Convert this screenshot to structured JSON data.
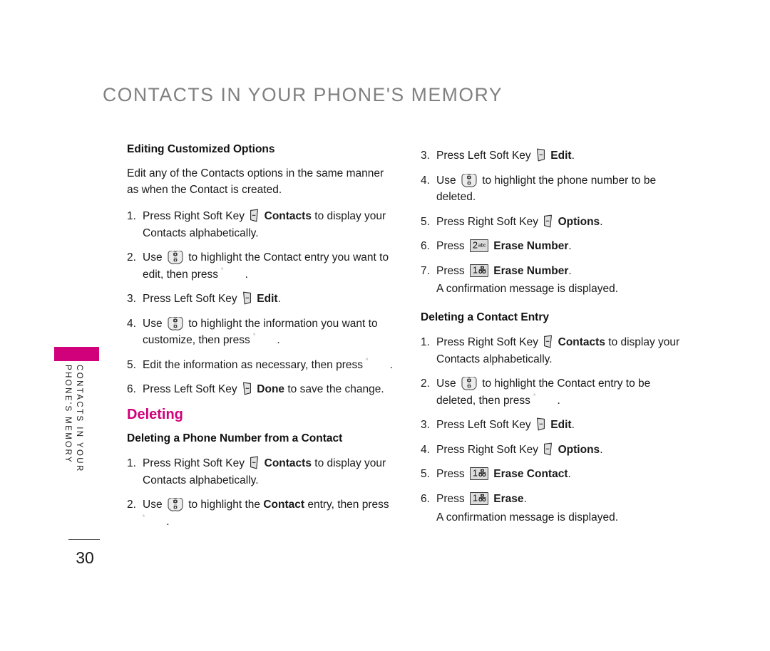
{
  "page": {
    "title": "CONTACTS IN YOUR PHONE'S MEMORY",
    "number": "30",
    "tab_color": "#d1007b",
    "heading_color": "#808080"
  },
  "side_tab": {
    "line1": "CONTACTS IN YOUR",
    "line2": "PHONE'S MEMORY"
  },
  "icons": {
    "left_soft_key": "left-soft-key-icon",
    "right_soft_key": "right-soft-key-icon",
    "nav_key": "navigation-key-icon",
    "ok_key": "ok-key-icon",
    "ok_label": "OK",
    "key_1": "number-key-1-icon",
    "key_1_digit": "1",
    "key_2": "number-key-2-icon",
    "key_2_digit": "2",
    "key_2_sub": "abc"
  },
  "left_column": {
    "editing_heading": "Editing Customized Options",
    "editing_intro": "Edit any of the Contacts options in the same manner as when the Contact is created.",
    "editing_steps": [
      {
        "num": "1.",
        "t1": "Press Right Soft Key",
        "icon": "right_soft_key",
        "bold": "Contacts",
        "t2": "to display your Contacts alphabetically."
      },
      {
        "num": "2.",
        "t1": "Use",
        "icon": "nav_key",
        "t2": "to highlight the Contact entry you want to edit, then press",
        "icon2": "ok_key",
        "t3": "."
      },
      {
        "num": "3.",
        "t1": "Press Left Soft Key",
        "icon": "left_soft_key",
        "bold": "Edit",
        "t2": "."
      },
      {
        "num": "4.",
        "t1": "Use",
        "icon": "nav_key",
        "t2": "to highlight the information you want to customize, then press",
        "icon2": "ok_key",
        "t3": "."
      },
      {
        "num": "5.",
        "t1": "Edit the information as necessary, then press",
        "icon2": "ok_key",
        "t3": "."
      },
      {
        "num": "6.",
        "t1": "Press Left Soft Key",
        "icon": "left_soft_key",
        "bold": "Done",
        "t2": "to save the change."
      }
    ],
    "deleting_heading": "Deleting",
    "delete_number_heading": "Deleting a Phone Number from a Contact",
    "delete_number_steps": [
      {
        "num": "1.",
        "t1": "Press Right Soft Key",
        "icon": "right_soft_key",
        "bold": "Contacts",
        "t2": "to display your Contacts alphabetically."
      },
      {
        "num": "2.",
        "t1": "Use",
        "icon": "nav_key",
        "t2": "to highlight the",
        "bold": "Contact",
        "t3": "entry, then press",
        "icon2": "ok_key",
        "t4": "."
      }
    ]
  },
  "right_column": {
    "delete_number_steps_cont": [
      {
        "num": "3.",
        "t1": "Press Left Soft Key",
        "icon": "left_soft_key",
        "bold": "Edit",
        "t2": "."
      },
      {
        "num": "4.",
        "t1": "Use",
        "icon": "nav_key",
        "t2": "to highlight the phone number to be deleted."
      },
      {
        "num": "5.",
        "t1": "Press Right Soft Key",
        "icon": "right_soft_key",
        "bold": "Options",
        "t2": "."
      },
      {
        "num": "6.",
        "t1": "Press",
        "icon": "key_2",
        "bold": "Erase Number",
        "t2": "."
      },
      {
        "num": "7.",
        "t1": "Press",
        "icon": "key_1",
        "bold": "Erase Number",
        "t2": ".",
        "note": "A confirmation message is displayed."
      }
    ],
    "delete_contact_heading": "Deleting a Contact Entry",
    "delete_contact_steps": [
      {
        "num": "1.",
        "t1": "Press Right Soft Key",
        "icon": "right_soft_key",
        "bold": "Contacts",
        "t2": "to display your Contacts alphabetically."
      },
      {
        "num": "2.",
        "t1": "Use",
        "icon": "nav_key",
        "t2": "to highlight the Contact entry to be deleted, then press",
        "icon2": "ok_key",
        "t3": "."
      },
      {
        "num": "3.",
        "t1": "Press Left Soft Key",
        "icon": "left_soft_key",
        "bold": "Edit",
        "t2": "."
      },
      {
        "num": "4.",
        "t1": "Press Right Soft Key",
        "icon": "right_soft_key",
        "bold": "Options",
        "t2": "."
      },
      {
        "num": "5.",
        "t1": "Press",
        "icon": "key_1",
        "bold": "Erase Contact",
        "t2": "."
      },
      {
        "num": "6.",
        "t1": "Press",
        "icon": "key_1",
        "bold": "Erase",
        "t2": ".",
        "note": "A confirmation message is displayed."
      }
    ]
  }
}
